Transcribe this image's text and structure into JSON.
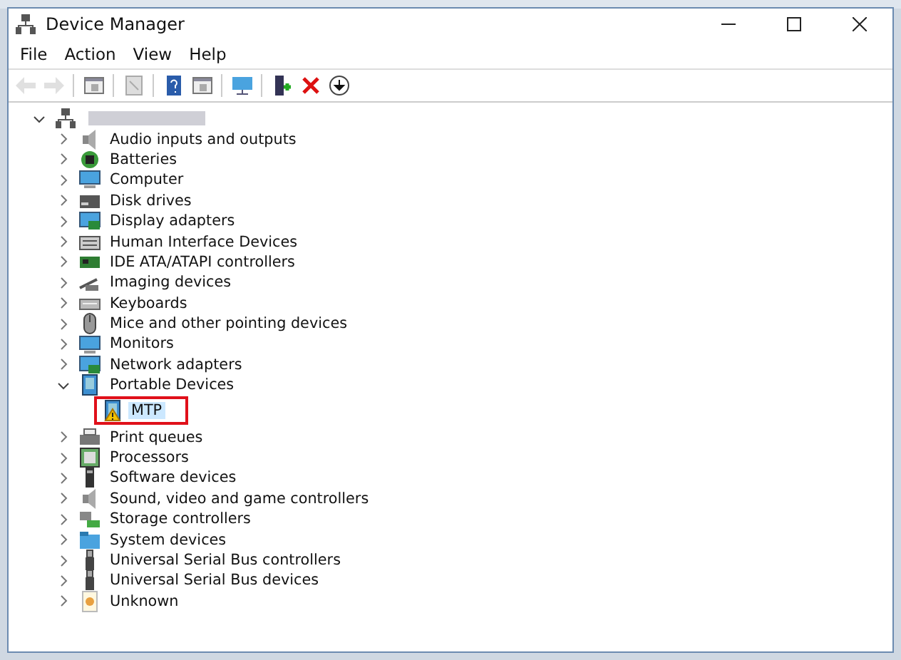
{
  "window": {
    "title": "Device Manager"
  },
  "menu": [
    "File",
    "Action",
    "View",
    "Help"
  ],
  "toolbar": [
    {
      "kind": "back",
      "disabled": true
    },
    {
      "kind": "forward",
      "disabled": true
    },
    {
      "kind": "sep"
    },
    {
      "kind": "pane"
    },
    {
      "kind": "sep"
    },
    {
      "kind": "page"
    },
    {
      "kind": "sep"
    },
    {
      "kind": "help"
    },
    {
      "kind": "pane"
    },
    {
      "kind": "sep"
    },
    {
      "kind": "monitor"
    },
    {
      "kind": "sep"
    },
    {
      "kind": "driver"
    },
    {
      "kind": "remove"
    },
    {
      "kind": "download"
    }
  ],
  "tree": {
    "root": {
      "expanded": true,
      "name_blurred": true
    },
    "items": [
      {
        "label": "Audio inputs and outputs",
        "kind": "speaker",
        "expanded": false
      },
      {
        "label": "Batteries",
        "kind": "battery",
        "expanded": false
      },
      {
        "label": "Computer",
        "kind": "monitor",
        "expanded": false
      },
      {
        "label": "Disk drives",
        "kind": "disk",
        "expanded": false
      },
      {
        "label": "Display adapters",
        "kind": "display",
        "expanded": false
      },
      {
        "label": "Human Interface Devices",
        "kind": "hid",
        "expanded": false
      },
      {
        "label": "IDE ATA/ATAPI controllers",
        "kind": "card",
        "expanded": false
      },
      {
        "label": "Imaging devices",
        "kind": "camera",
        "expanded": false
      },
      {
        "label": "Keyboards",
        "kind": "keyboard",
        "expanded": false
      },
      {
        "label": "Mice and other pointing devices",
        "kind": "mouse",
        "expanded": false
      },
      {
        "label": "Monitors",
        "kind": "monitor",
        "expanded": false
      },
      {
        "label": "Network adapters",
        "kind": "display",
        "expanded": false
      },
      {
        "label": "Portable Devices",
        "kind": "portable",
        "expanded": true,
        "children": [
          {
            "label": "MTP",
            "kind": "portable",
            "warning": true,
            "selected": true,
            "annotated": true
          }
        ]
      },
      {
        "label": "Print queues",
        "kind": "printer",
        "expanded": false
      },
      {
        "label": "Processors",
        "kind": "chip",
        "expanded": false
      },
      {
        "label": "Software devices",
        "kind": "software",
        "expanded": false
      },
      {
        "label": "Sound, video and game controllers",
        "kind": "speaker",
        "expanded": false
      },
      {
        "label": "Storage controllers",
        "kind": "storage",
        "expanded": false
      },
      {
        "label": "System devices",
        "kind": "folder",
        "expanded": false
      },
      {
        "label": "Universal Serial Bus controllers",
        "kind": "usb",
        "expanded": false
      },
      {
        "label": "Universal Serial Bus devices",
        "kind": "usb",
        "expanded": false
      },
      {
        "label": "Unknown",
        "kind": "unknown",
        "expanded": false
      }
    ]
  }
}
